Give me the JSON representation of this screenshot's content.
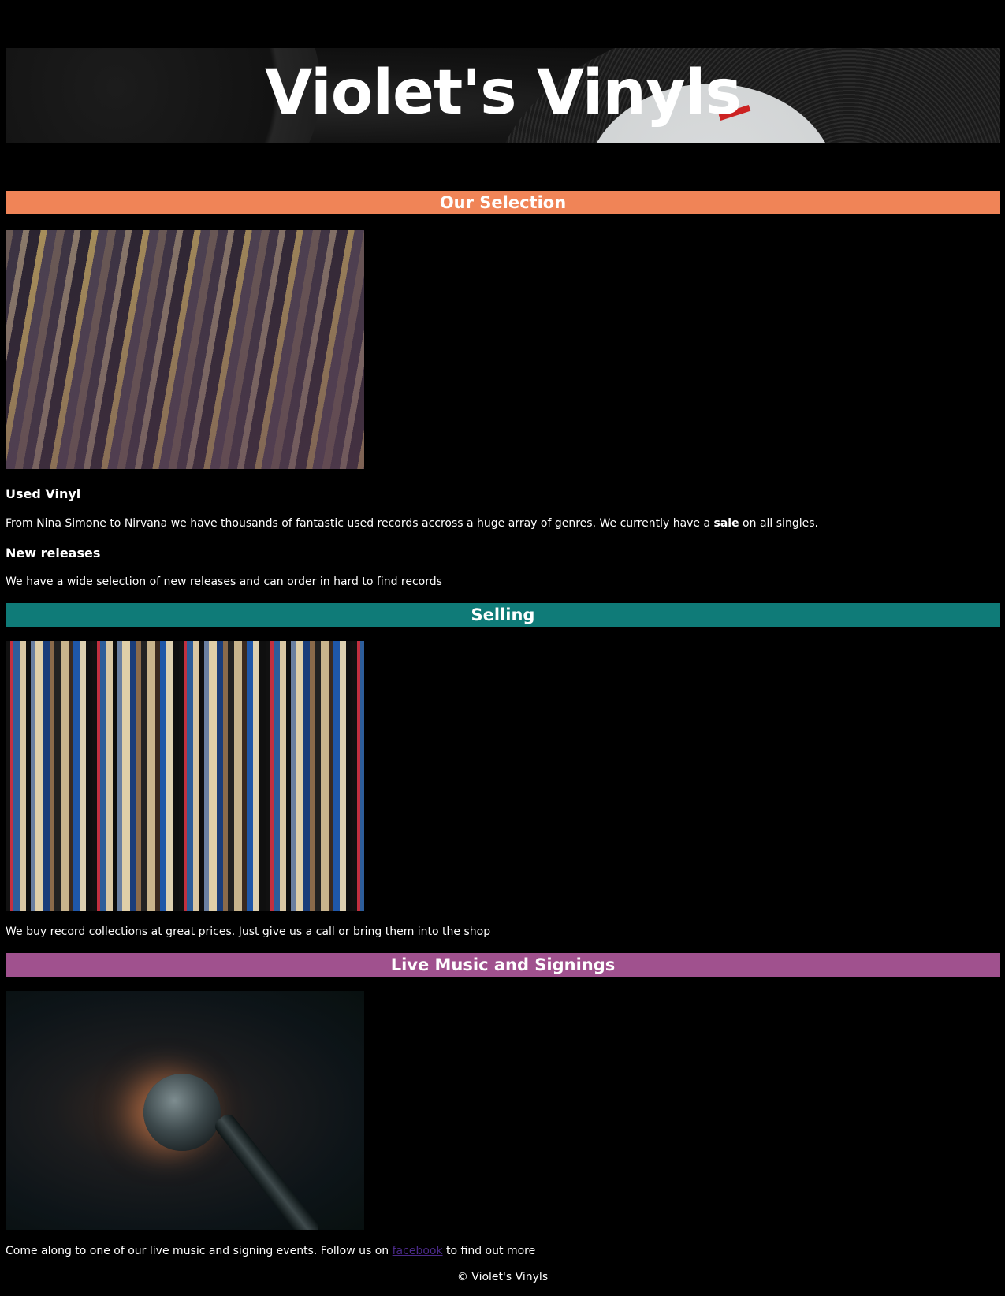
{
  "header": {
    "title": "Violet's Vinyls"
  },
  "sections": {
    "selection": {
      "heading": "Our Selection",
      "color": "#f08457",
      "used_title": "Used Vinyl",
      "used_text_before": "From Nina Simone to Nirvana we have thousands of fantastic used records accross a huge array of genres. We currently have a ",
      "used_text_bold": "sale",
      "used_text_after": " on all singles.",
      "new_title": "New releases",
      "new_text": "We have a wide selection of new releases and can order in hard to find records"
    },
    "selling": {
      "heading": "Selling",
      "color": "#0f7b78",
      "text": "We buy record collections at great prices. Just give us a call or bring them into the shop"
    },
    "live": {
      "heading": "Live Music and Signings",
      "color": "#a0518e",
      "text_before": "Come along to one of our live music and signing events. Follow us on ",
      "link_text": "facebook",
      "text_after": " to find out more"
    }
  },
  "footer": {
    "text": "© Violet's Vinyls"
  }
}
